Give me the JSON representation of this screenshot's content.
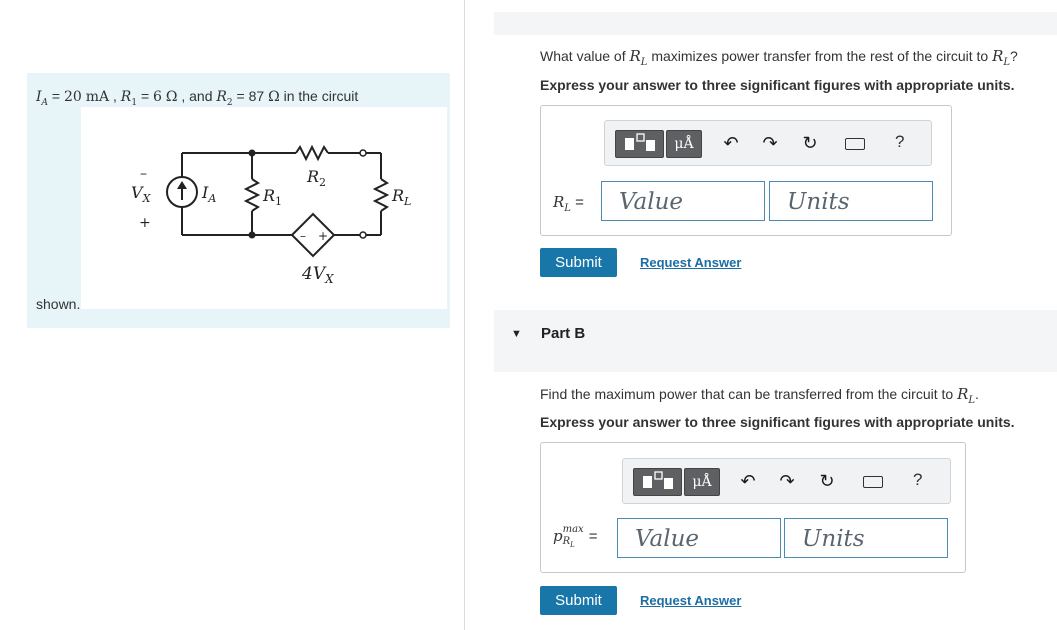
{
  "problem": {
    "statement_suffix": "in the circuit",
    "statement_end": "shown.",
    "given": {
      "IA_sym": "I",
      "IA_sub": "A",
      "IA_val": "20",
      "IA_unit": "mA",
      "R1_sym": "R",
      "R1_sub": "1",
      "R1_val": "6",
      "R1_unit": "Ω",
      "R2_sym": "R",
      "R2_sub": "2",
      "R2_val": "87",
      "R2_unit": "Ω",
      "and": "and"
    },
    "circuit": {
      "vx_label": "V",
      "vx_sub": "X",
      "minus": "–",
      "plus": "+",
      "ia_label": "I",
      "ia_sub": "A",
      "r1_label": "R",
      "r1_sub": "1",
      "r2_label": "R",
      "r2_sub": "2",
      "rl_label": "R",
      "rl_sub": "L",
      "dep_label": "4V",
      "dep_sub": "X",
      "dep_minus": "–",
      "dep_plus": "+"
    }
  },
  "partA": {
    "question_pre": "What value of",
    "question_mid": "maximizes power transfer from the rest of the circuit to",
    "question_end": "?",
    "var": "R",
    "var_sub": "L",
    "instruction": "Express your answer to three significant figures with appropriate units.",
    "answer_label": "R",
    "answer_label_sub": "L",
    "equals": "=",
    "value_placeholder": "Value",
    "units_placeholder": "Units",
    "unit_button": "μÅ",
    "help": "?",
    "submit": "Submit",
    "request_answer": "Request Answer"
  },
  "partB": {
    "title": "Part B",
    "question_pre": "Find the maximum power that can be transferred from the circuit to",
    "question_end": ".",
    "var": "R",
    "var_sub": "L",
    "instruction": "Express your answer to three significant figures with appropriate units.",
    "answer_label": "p",
    "answer_label_sup": "max",
    "answer_label_sub": "R",
    "answer_label_subsub": "L",
    "equals": "=",
    "value_placeholder": "Value",
    "units_placeholder": "Units",
    "unit_button": "μÅ",
    "help": "?",
    "submit": "Submit",
    "request_answer": "Request Answer"
  },
  "icons": [
    "templates-icon",
    "units-icon",
    "undo-icon",
    "redo-icon",
    "reset-icon",
    "keyboard-icon",
    "help-icon",
    "collapse-arrow-icon"
  ]
}
